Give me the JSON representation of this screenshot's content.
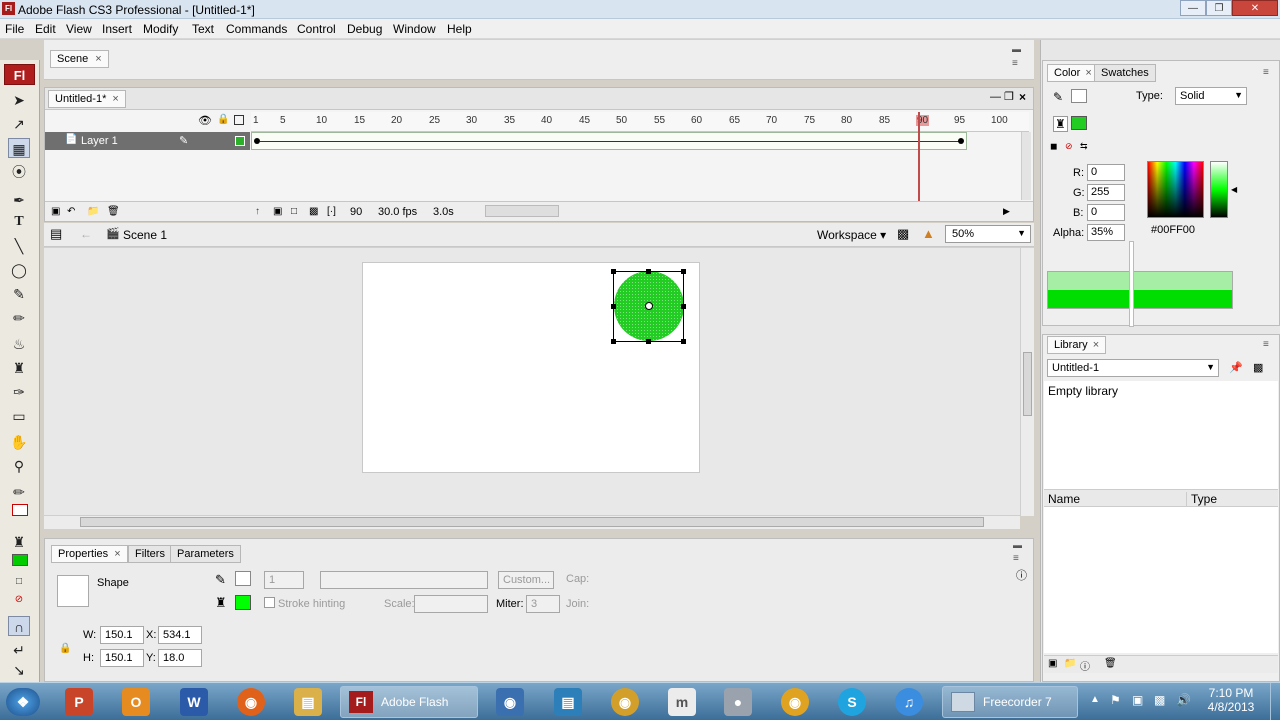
{
  "window": {
    "title": "Adobe Flash CS3 Professional - [Untitled-1*]",
    "app_icon": "Fl"
  },
  "menu": [
    "File",
    "Edit",
    "View",
    "Insert",
    "Modify",
    "Text",
    "Commands",
    "Control",
    "Debug",
    "Window",
    "Help"
  ],
  "tools": {
    "logo": "Fl"
  },
  "doc": {
    "scene_tab": "Scene",
    "doc_tab": "Untitled-1*"
  },
  "timeline": {
    "layer_name": "Layer 1",
    "ruler": [
      "1",
      "5",
      "10",
      "15",
      "20",
      "25",
      "30",
      "35",
      "40",
      "45",
      "50",
      "55",
      "60",
      "65",
      "70",
      "75",
      "80",
      "85",
      "90",
      "95",
      "100"
    ],
    "current_frame": "90",
    "fps": "30.0 fps",
    "time": "3.0s",
    "current_frame_fraction": 0.89
  },
  "edit_bar": {
    "scene_label": "Scene 1",
    "workspace": "Workspace",
    "zoom": "50%"
  },
  "properties": {
    "tabs": [
      "Properties",
      "Filters",
      "Parameters"
    ],
    "type_label": "Shape",
    "stroke_height": "1",
    "custom_button": "Custom...",
    "cap_label": "Cap:",
    "stroke_hinting": "Stroke hinting",
    "scale_label": "Scale:",
    "miter_label": "Miter:",
    "miter_value": "3",
    "join_label": "Join:",
    "w_label": "W:",
    "w": "150.1",
    "h_label": "H:",
    "h": "150.1",
    "x_label": "X:",
    "x": "534.1",
    "y_label": "Y:",
    "y": "18.0",
    "fill_color": "#00FF00"
  },
  "color_panel": {
    "tabs": [
      "Color",
      "Swatches"
    ],
    "type_label": "Type:",
    "type_value": "Solid",
    "r_label": "R:",
    "r": "0",
    "g_label": "G:",
    "g": "255",
    "b_label": "B:",
    "b": "0",
    "alpha_label": "Alpha:",
    "alpha": "35%",
    "hex": "#00FF00"
  },
  "library_panel": {
    "tab": "Library",
    "doc": "Untitled-1",
    "empty_text": "Empty library",
    "col_name": "Name",
    "col_type": "Type"
  },
  "taskbar": {
    "tasks": [
      "Adobe Flash CS...",
      "Freecorder 7 Scr..."
    ],
    "time": "7:10 PM",
    "date": "4/8/2013"
  }
}
